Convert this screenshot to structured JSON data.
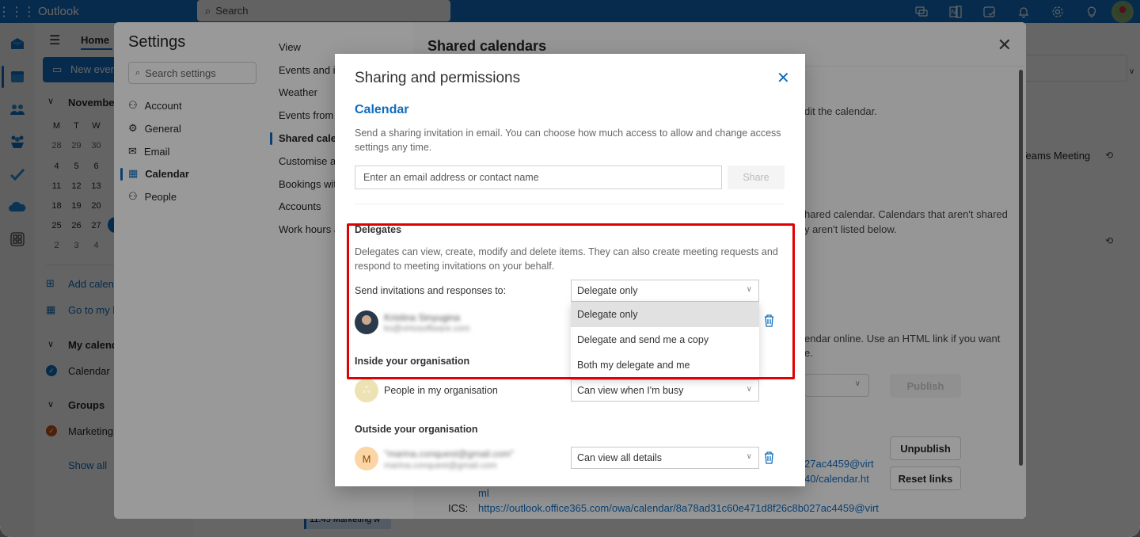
{
  "topbar": {
    "app_name": "Outlook",
    "search_placeholder": "Search",
    "icons": [
      "teams-chat-icon",
      "onenote-icon",
      "my-day-icon",
      "bell-icon",
      "gear-icon",
      "lightbulb-icon"
    ]
  },
  "left_pane": {
    "home_tab": "Home",
    "new_event": "New event",
    "month": "November",
    "weekday_headers": [
      "M",
      "T",
      "W"
    ],
    "weeks": [
      [
        "28",
        "29",
        "30"
      ],
      [
        "4",
        "5",
        "6"
      ],
      [
        "11",
        "12",
        "13"
      ],
      [
        "18",
        "19",
        "20"
      ],
      [
        "25",
        "26",
        "27"
      ],
      [
        "2",
        "3",
        "4"
      ]
    ],
    "add_calendar": "Add calendar",
    "go_to_bookings": "Go to my booking page",
    "my_calendars_header": "My calendars",
    "my_calendars": [
      {
        "label": "Calendar",
        "color": "#0f6cbd"
      }
    ],
    "groups_header": "Groups",
    "groups": [
      {
        "label": "Marketing",
        "color": "#c4501a"
      }
    ],
    "show_all": "Show all"
  },
  "background_calendar": {
    "event_text": "Teams Meeting",
    "bottom_event": "11:45 Marketing w"
  },
  "settings": {
    "title": "Settings",
    "search_placeholder": "Search settings",
    "nav": [
      {
        "label": "Account",
        "icon": "person-icon"
      },
      {
        "label": "General",
        "icon": "gear-icon"
      },
      {
        "label": "Email",
        "icon": "mail-icon"
      },
      {
        "label": "Calendar",
        "icon": "calendar-icon",
        "active": true
      },
      {
        "label": "People",
        "icon": "people-icon"
      }
    ],
    "subnav": [
      {
        "label": "View"
      },
      {
        "label": "Events and invitations"
      },
      {
        "label": "Weather"
      },
      {
        "label": "Events from email"
      },
      {
        "label": "Shared calendars",
        "active": true
      },
      {
        "label": "Customise actions"
      },
      {
        "label": "Bookings with me"
      },
      {
        "label": "Accounts"
      },
      {
        "label": "Work hours and location"
      }
    ],
    "content": {
      "title": "Shared calendars",
      "text1": "dit the calendar.",
      "text2a": "hared calendar. Calendars that aren't shared",
      "text2b": "y aren't listed below.",
      "text3a": "endar online. Use an HTML link if you want",
      "text3b": "e.",
      "publish_button": "Publish",
      "unpublish_button": "Unpublish",
      "reset_links_button": "Reset links",
      "html_link_tail1": "27ac4459@virt",
      "html_link_tail2": "40/calendar.ht",
      "html_link_tail3": "ml",
      "ics_label": "ICS:",
      "ics_link": "https://outlook.office365.com/owa/calendar/8a78ad31c60e471d8f26c8b027ac4459@virt"
    }
  },
  "modal": {
    "title": "Sharing and permissions",
    "section": "Calendar",
    "description": "Send a sharing invitation in email. You can choose how much access to allow and change access settings any time.",
    "email_placeholder": "Enter an email address or contact name",
    "share_button": "Share",
    "delegates": {
      "header": "Delegates",
      "description": "Delegates can view, create, modify and delete items. They can also create meeting requests and respond to meeting invitations on your behalf.",
      "send_label": "Send invitations and responses to:",
      "send_value": "Delegate only",
      "options": [
        "Delegate only",
        "Delegate and send me a copy",
        "Both my delegate and me"
      ],
      "selected_option": "Delegate only",
      "delegate_name": "Kristina Sinyugina",
      "delegate_email": "ks@virtosoftware.com"
    },
    "inside": {
      "header": "Inside your organisation",
      "label": "People in my organisation",
      "permission": "Can view when I'm busy"
    },
    "outside": {
      "header": "Outside your organisation",
      "avatar_initial": "M",
      "name": "\"marina.conquest@gmail.com\"",
      "email": "marina.conquest@gmail.com",
      "permission": "Can view all details"
    }
  },
  "colors": {
    "accent": "#0f6cbd",
    "highlight_box": "#e00000"
  }
}
